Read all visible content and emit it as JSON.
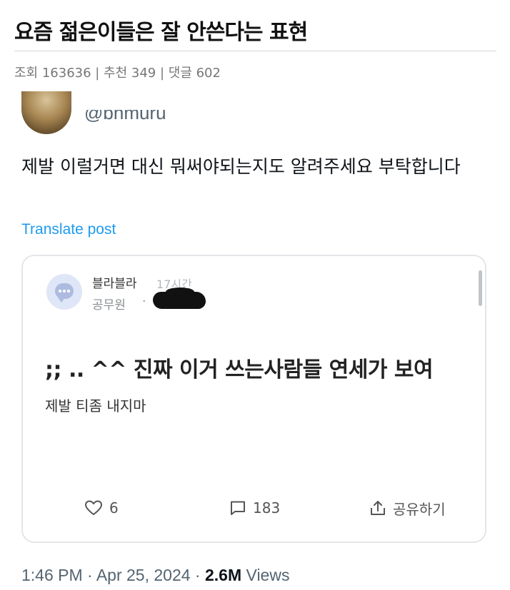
{
  "post": {
    "title": "요즘 젊은이들은 잘 안쓴다는 표현",
    "meta": "조회 163636 | 추천 349 | 댓글 602"
  },
  "tweet": {
    "handle": "@bhmuru",
    "text": "제발 이럴거면 대신 뭐써야되는지도 알려주세요 부탁합니다",
    "translate_label": "Translate post",
    "timestamp": "1:46 PM · Apr 25, 2024 · ",
    "views_count": "2.6M",
    "views_label": " Views"
  },
  "embed": {
    "username": "블라블라",
    "time_ago": "17시간",
    "job": "공무원",
    "separator": "·",
    "headline": ";; .. ^^ 진짜 이거 쓰는사람들 연세가 보여",
    "body": "제발 티좀 내지마",
    "likes": "6",
    "comments": "183",
    "share_label": "공유하기"
  },
  "icons": {
    "avatar": "chat-bubble-icon",
    "like": "heart-icon",
    "comment": "comment-icon",
    "share": "share-icon"
  },
  "colors": {
    "link": "#1d9bf0",
    "muted": "#536471",
    "text": "#0f1419"
  }
}
